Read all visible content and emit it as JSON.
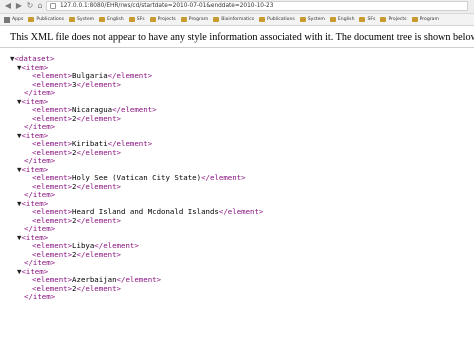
{
  "browser": {
    "url": "127.0.0.1:8080/EHR/rws/cd/startdate=2010-07-01&enddate=2010-10-23",
    "bookmarks": [
      "Apps",
      "Publications",
      "System",
      "English",
      "SFs",
      "Projects",
      "Program",
      "Bioinformatics",
      "Publications",
      "System",
      "English",
      "SFs",
      "Projects",
      "Program"
    ]
  },
  "notice": "This XML file does not appear to have any style information associated with it. The document tree is shown below.",
  "tree": {
    "root_tag": "<dataset>",
    "items": [
      {
        "open": "<item>",
        "country": "Bulgaria",
        "count": "3",
        "close": "</item>"
      },
      {
        "open": "<item>",
        "country": "Nicaragua",
        "count": "2",
        "close": "</item>"
      },
      {
        "open": "<item>",
        "country": "Kiribati",
        "count": "2",
        "close": "</item>"
      },
      {
        "open": "<item>",
        "country": "Holy See (Vatican City State)",
        "count": "2",
        "close": "</item>"
      },
      {
        "open": "<item>",
        "country": "Heard Island and Mcdonald Islands",
        "count": "2",
        "close": "</item>"
      },
      {
        "open": "<item>",
        "country": "Libya",
        "count": "2",
        "close": "</item>"
      },
      {
        "open": "<item>",
        "country": "Azerbaijan",
        "count": "2",
        "close": "</item>"
      }
    ],
    "element_open": "<element>",
    "element_close": "</element>"
  }
}
